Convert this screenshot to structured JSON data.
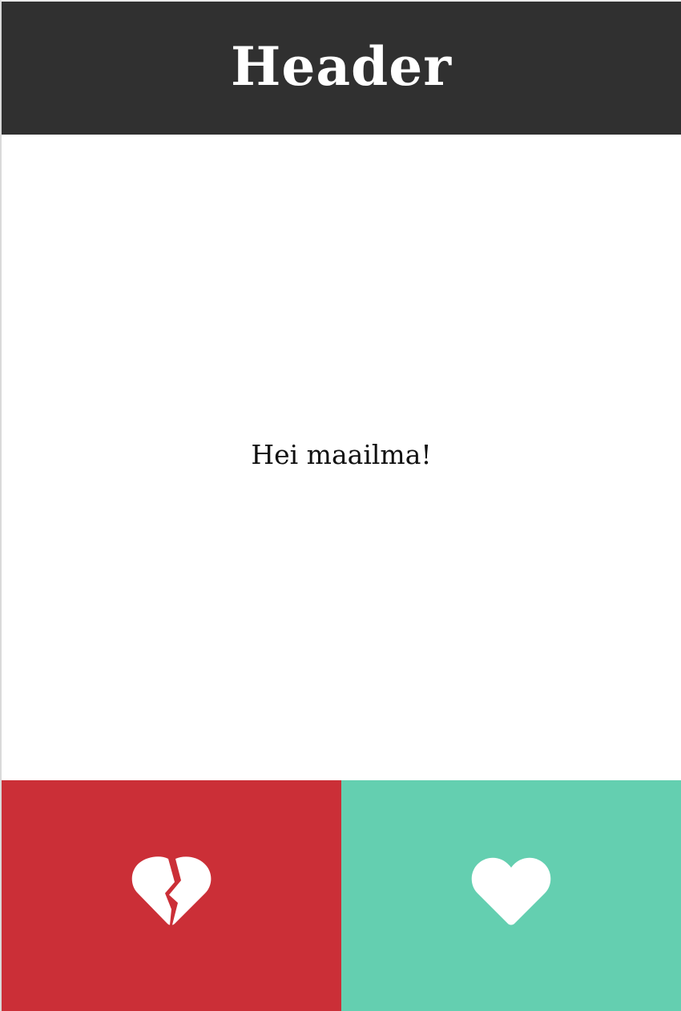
{
  "header": {
    "title": "Header"
  },
  "content": {
    "text": "Hei maailma!"
  },
  "actions": {
    "dislike": {
      "icon": "broken-heart-icon",
      "color": "#cb2f37"
    },
    "like": {
      "icon": "heart-icon",
      "color": "#64cfb0"
    }
  },
  "theme": {
    "header_bg": "#303030",
    "header_text": "#ffffff",
    "body_bg": "#ffffff",
    "body_text": "#111111",
    "icon_color": "#ffffff"
  }
}
